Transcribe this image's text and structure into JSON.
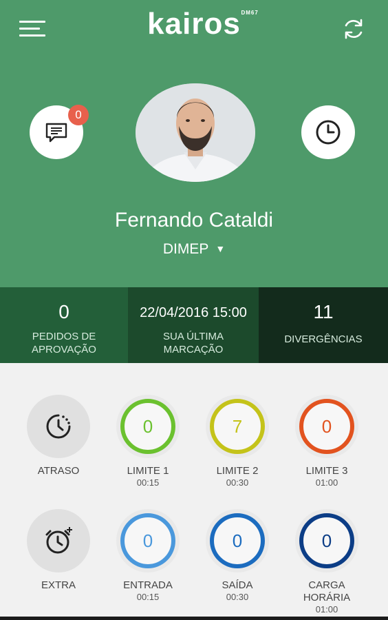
{
  "header": {
    "brand": "kairos",
    "brand_tm": "DM67",
    "icons": {
      "menu": "menu-icon",
      "refresh": "refresh-icon",
      "messages": "chat-icon",
      "clock": "clock-icon"
    },
    "messages_badge": "0"
  },
  "profile": {
    "name": "Fernando Cataldi",
    "company": "DIMEP",
    "company_caret": "▼"
  },
  "stats": [
    {
      "value": "0",
      "label_line1": "PEDIDOS DE",
      "label_line2": "APROVAÇÃO"
    },
    {
      "value": "22/04/2016 15:00",
      "label_line1": "SUA ÚLTIMA",
      "label_line2": "MARCAÇÃO"
    },
    {
      "value": "11",
      "label_line1": "DIVERGÊNCIAS",
      "label_line2": ""
    }
  ],
  "tiles": [
    {
      "label": "ATRASO",
      "sub": "",
      "icon": "clock-late-icon"
    },
    {
      "label": "LIMITE 1",
      "sub": "00:15",
      "value": "0",
      "color": "#6bc12f"
    },
    {
      "label": "LIMITE 2",
      "sub": "00:30",
      "value": "7",
      "color": "#c4c31a"
    },
    {
      "label": "LIMITE 3",
      "sub": "01:00",
      "value": "0",
      "color": "#e2531f"
    },
    {
      "label": "EXTRA",
      "sub": "",
      "icon": "clock-extra-icon"
    },
    {
      "label": "ENTRADA",
      "sub": "00:15",
      "value": "0",
      "color": "#4a98dc"
    },
    {
      "label": "SAÍDA",
      "sub": "00:30",
      "value": "0",
      "color": "#1c6cbf"
    },
    {
      "label_line1": "CARGA",
      "label_line2": "HORÁRIA",
      "sub": "01:00",
      "value": "0",
      "color": "#0c3d86"
    }
  ],
  "colors": {
    "header_green": "#4e9a6a",
    "stat_dark_1": "#235f39",
    "stat_dark_2": "#1c4a2c",
    "stat_dark_3": "#132b1c",
    "badge_red": "#e8604c"
  }
}
